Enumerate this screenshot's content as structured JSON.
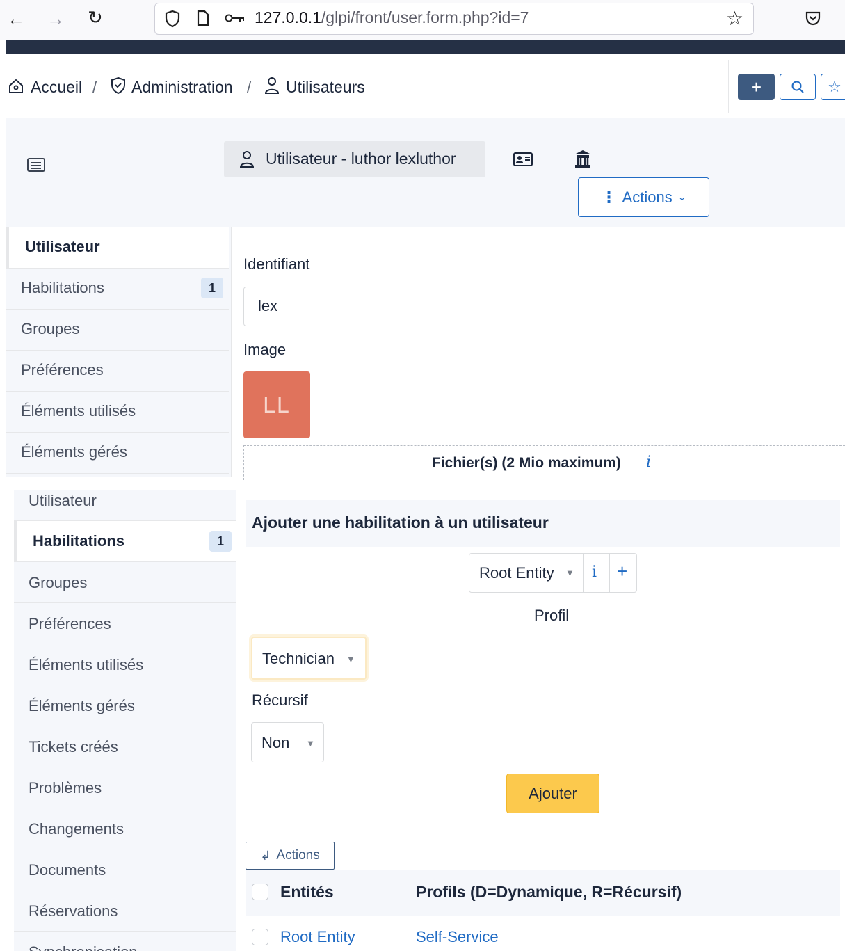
{
  "browser": {
    "url_host": "127.0.0.1",
    "url_path": "/glpi/front/user.form.php?id=7"
  },
  "breadcrumb": {
    "home": "Accueil",
    "admin": "Administration",
    "users": "Utilisateurs",
    "separator": "/"
  },
  "header_buttons": {
    "add": "+"
  },
  "item": {
    "title": "Utilisateur - luthor lexluthor",
    "actions_label": "Actions"
  },
  "tabs_upper": [
    {
      "label": "Utilisateur"
    },
    {
      "label": "Habilitations",
      "badge": "1"
    },
    {
      "label": "Groupes"
    },
    {
      "label": "Préférences"
    },
    {
      "label": "Éléments utilisés"
    },
    {
      "label": "Éléments gérés"
    }
  ],
  "form": {
    "login_label": "Identifiant",
    "login_value": "lex",
    "image_label": "Image",
    "avatar_initials": "LL",
    "dropzone_label": "Fichier(s) (2 Mio maximum)",
    "dropzone_info": "i"
  },
  "tabs_lower": [
    {
      "label": "Utilisateur"
    },
    {
      "label": "Habilitations",
      "badge": "1"
    },
    {
      "label": "Groupes"
    },
    {
      "label": "Préférences"
    },
    {
      "label": "Éléments utilisés"
    },
    {
      "label": "Éléments gérés"
    },
    {
      "label": "Tickets créés"
    },
    {
      "label": "Problèmes"
    },
    {
      "label": "Changements"
    },
    {
      "label": "Documents"
    },
    {
      "label": "Réservations"
    },
    {
      "label": "Synchronisation"
    }
  ],
  "habilitation": {
    "section_title": "Ajouter une habilitation à un utilisateur",
    "entity_value": "Root Entity",
    "entity_info": "i",
    "entity_add": "+",
    "profile_label": "Profil",
    "profile_value": "Technician",
    "recursive_label": "Récursif",
    "recursive_value": "Non",
    "add_button": "Ajouter"
  },
  "table": {
    "actions_label": "Actions",
    "columns": [
      "Entités",
      "Profils (D=Dynamique, R=Récursif)"
    ],
    "rows": [
      {
        "entity": "Root Entity",
        "profile": "Self-Service"
      }
    ]
  },
  "colors": {
    "accent": "#206bc4",
    "warning_button": "#fcc94d",
    "avatar_bg": "#e0735c",
    "nav_dark": "#253045"
  }
}
